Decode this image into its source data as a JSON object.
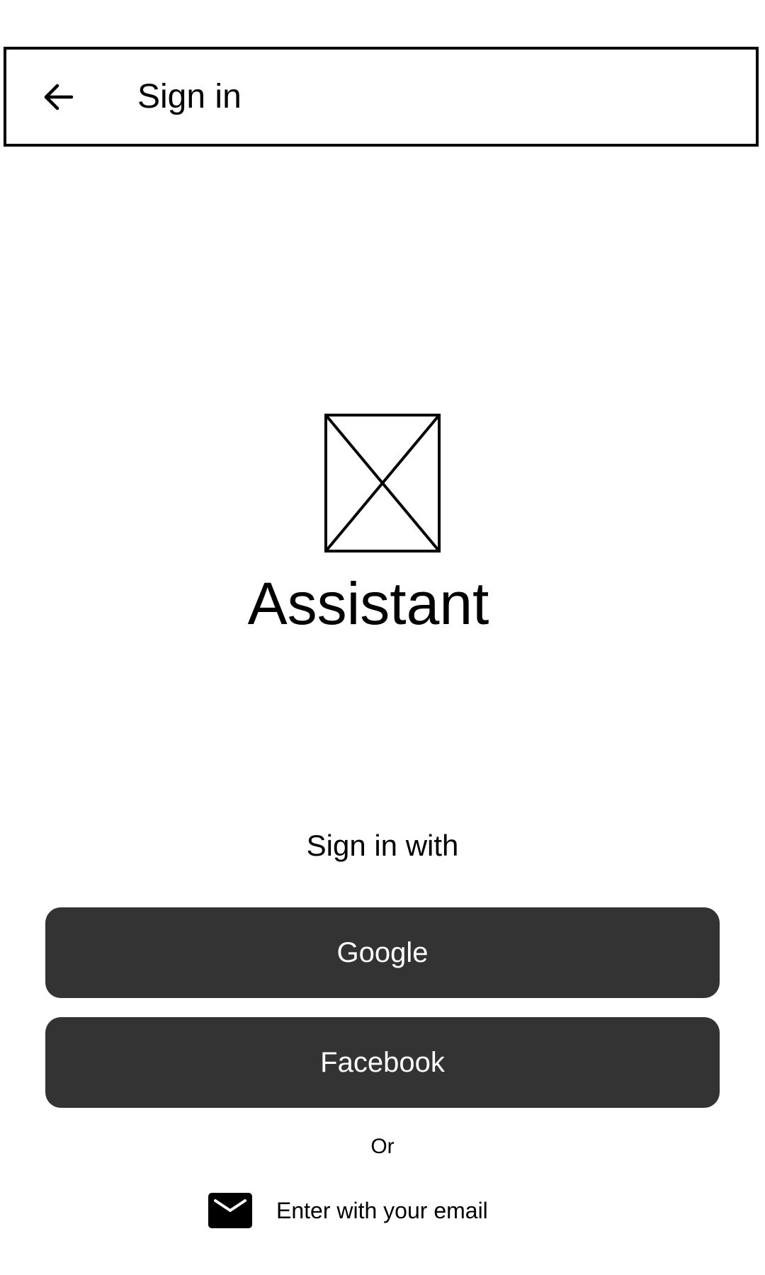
{
  "header": {
    "back_icon": "arrow-left-icon",
    "title": "Sign in"
  },
  "branding": {
    "logo_icon": "image-placeholder-icon",
    "app_name": "Assistant"
  },
  "sign_in": {
    "prompt": "Sign in with",
    "providers": [
      {
        "label": "Google"
      },
      {
        "label": "Facebook"
      }
    ],
    "separator": "Or",
    "email_icon": "mail-icon",
    "email_label": "Enter with your email"
  },
  "colors": {
    "button_bg": "#333333",
    "button_text": "#ffffff",
    "text": "#000000",
    "background": "#ffffff"
  }
}
